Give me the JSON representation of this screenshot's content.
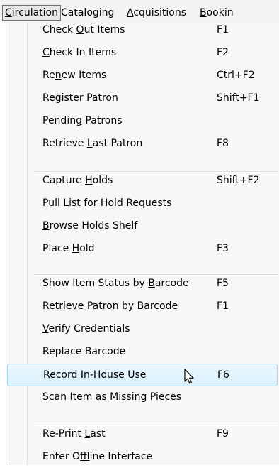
{
  "menubar": {
    "items": [
      {
        "label": "Circulation",
        "accel": "C"
      },
      {
        "label": "Cataloging",
        "accel": ""
      },
      {
        "label": "Acquisitions",
        "accel": "A"
      },
      {
        "label": "Bookin",
        "accel": "B"
      }
    ]
  },
  "menu": {
    "groups": [
      [
        {
          "pre": "Check ",
          "acc": "O",
          "post": "ut Items",
          "key": "F1"
        },
        {
          "pre": "",
          "acc": "C",
          "post": "heck In Items",
          "key": "F2"
        },
        {
          "pre": "Re",
          "acc": "n",
          "post": "ew Items",
          "key": "Ctrl+F2"
        },
        {
          "pre": "",
          "acc": "R",
          "post": "egister Patron",
          "key": "Shift+F1"
        },
        {
          "pre": "Pendin",
          "acc": "g",
          "post": " Patrons",
          "key": ""
        },
        {
          "pre": "Retrieve ",
          "acc": "L",
          "post": "ast Patron",
          "key": "F8"
        }
      ],
      [
        {
          "pre": "Capture ",
          "acc": "H",
          "post": "olds",
          "key": "Shift+F2"
        },
        {
          "pre": "Pull Li",
          "acc": "s",
          "post": "t for Hold Requests",
          "key": ""
        },
        {
          "pre": "",
          "acc": "B",
          "post": "rowse Holds Shelf",
          "key": ""
        },
        {
          "pre": "Place ",
          "acc": "H",
          "post": "old",
          "key": "F3"
        }
      ],
      [
        {
          "pre": "Show Item Status by ",
          "acc": "B",
          "post": "arcode",
          "key": "F5"
        },
        {
          "pre": "Retrieve ",
          "acc": "P",
          "post": "atron by Barcode",
          "key": "F1"
        },
        {
          "pre": "",
          "acc": "V",
          "post": "erify Credentials",
          "key": ""
        },
        {
          "pre": "Replace Barcode",
          "acc": "",
          "post": "",
          "key": ""
        },
        {
          "pre": "Record ",
          "acc": "I",
          "post": "n-House Use",
          "key": "F6",
          "highlighted": true
        },
        {
          "pre": "Scan Item as ",
          "acc": "M",
          "post": "issing Pieces",
          "key": ""
        }
      ],
      [
        {
          "pre": "Re-Print ",
          "acc": "L",
          "post": "ast",
          "key": "F9"
        },
        {
          "pre": "Enter O",
          "acc": "f",
          "post": "fline Interface",
          "key": ""
        }
      ]
    ]
  },
  "cursor": {
    "icon": "mouse-pointer-icon"
  }
}
